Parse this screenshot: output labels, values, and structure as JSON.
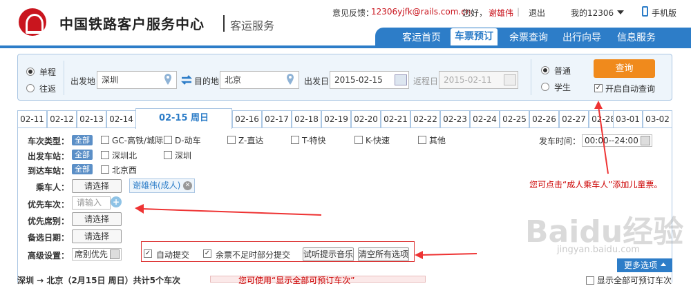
{
  "header": {
    "logo_title": "中国铁路客户服务中心",
    "logo_sub": "客运服务",
    "feedback_label": "意见反馈：",
    "feedback_email": "12306yjfk@rails.com.cn",
    "greeting": "您好，",
    "username": "谢雄伟",
    "logout": "退出",
    "my12306": "我的12306",
    "mobile": "手机版"
  },
  "nav": {
    "items": [
      "客运首页",
      "车票预订",
      "余票查询",
      "出行向导",
      "信息服务"
    ],
    "active": "车票预订"
  },
  "search": {
    "one_way": "单程",
    "round_trip": "往返",
    "from_label": "出发地",
    "from_value": "深圳",
    "to_label": "目的地",
    "to_value": "北京",
    "depart_label": "出发日",
    "depart_value": "2015-02-15",
    "return_label": "返程日",
    "return_value": "2015-02-11",
    "normal": "普通",
    "student": "学生",
    "query_button": "查询",
    "auto_query": "开启自动查询"
  },
  "dates": {
    "before": [
      "02-11",
      "02-12",
      "02-13",
      "02-14"
    ],
    "active": "02-15 周日",
    "after": [
      "02-16",
      "02-17",
      "02-18",
      "02-19",
      "02-20",
      "02-21",
      "02-22",
      "02-23",
      "02-24",
      "02-25",
      "02-26",
      "02-27",
      "02-28",
      "03-01",
      "03-02"
    ]
  },
  "filters": {
    "train_type_label": "车次类型：",
    "all": "全部",
    "types": [
      "GC-高铁/城际",
      "D-动车",
      "Z-直达",
      "T-特快",
      "K-快速",
      "其他"
    ],
    "depart_time_label": "发车时间：",
    "depart_time_value": "00:00--24:00",
    "from_station_label": "出发车站：",
    "from_stations": [
      "深圳北",
      "深圳"
    ],
    "to_station_label": "到达车站：",
    "to_stations": [
      "北京西"
    ],
    "passenger_label": "乘车人：",
    "select": "请选择",
    "passenger_tag": "谢雄伟(成人)",
    "priority_train_label": "优先车次：",
    "priority_train_placeholder": "请输入",
    "priority_seat_label": "优先席别：",
    "backup_date_label": "备选日期：",
    "advanced_label": "高级设置：",
    "seat_priority": "席别优先",
    "auto_submit": "自动提交",
    "partial_submit": "余票不足时部分提交",
    "test_music": "试听提示音乐",
    "clear_all": "清空所有选项",
    "more": "更多选项"
  },
  "annotation": "您可点击“成人乘车人”添加儿童票。",
  "bottom": {
    "route": "深圳 → 北京（2月15日 周日）共计5个车次",
    "notice": "您可使用“显示全部可预订车次”",
    "show_all": "显示全部可预订车次"
  },
  "watermark": {
    "main": "Baidu经验",
    "sub": "jingyan.baidu.com"
  },
  "colors": {
    "brand_blue": "#2d7dc8",
    "query_orange": "#f08a1c",
    "annotation_red": "#cc0000"
  }
}
